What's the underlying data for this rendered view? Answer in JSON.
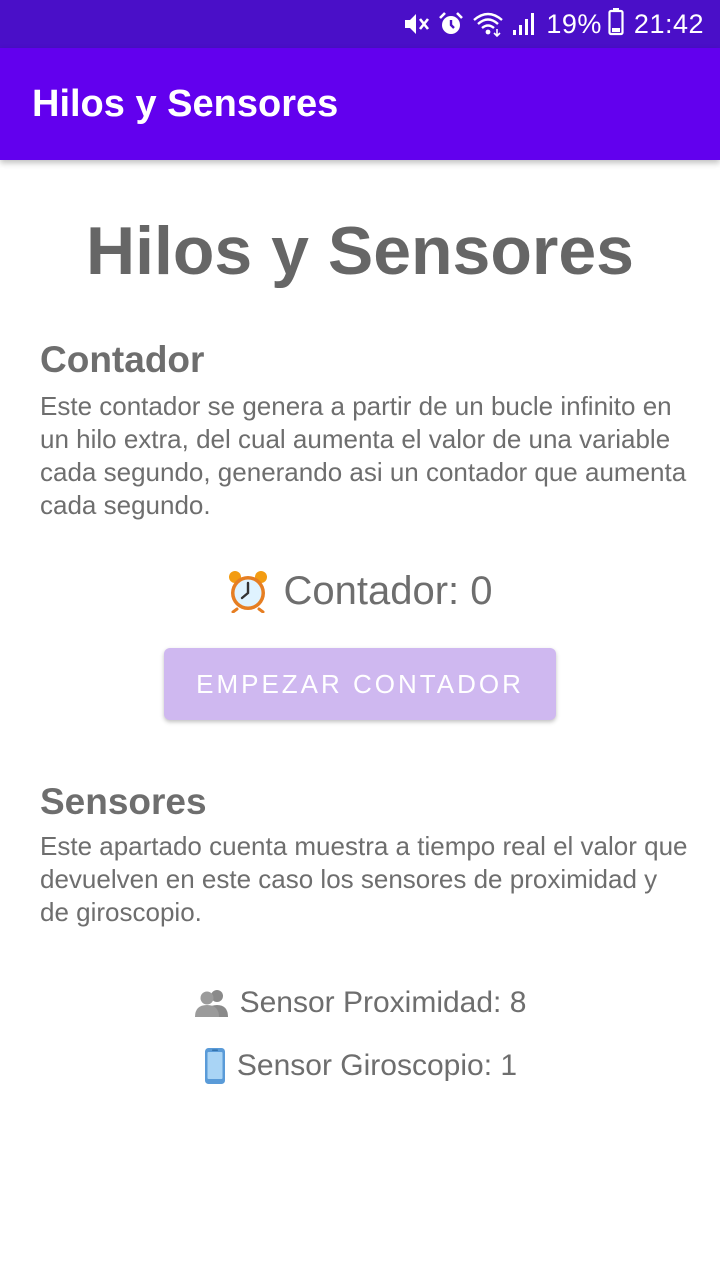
{
  "status_bar": {
    "battery_percent": "19%",
    "time": "21:42",
    "icons": [
      "mute-icon",
      "alarm-icon",
      "wifi-icon",
      "signal-icon",
      "battery-icon"
    ],
    "background_color": "#4a0fc8"
  },
  "app_bar": {
    "title": "Hilos y Sensores",
    "background_color": "#6200ee"
  },
  "main": {
    "page_title": "Hilos y Sensores",
    "counter_section": {
      "title": "Contador",
      "description": "Este contador se genera a partir de un bucle infinito en un hilo extra, del cual aumenta el valor de una variable cada segundo, generando asi un contador que aumenta cada segundo.",
      "counter_icon": "alarm-clock-icon",
      "counter_text": "Contador: 0",
      "button_label": "EMPEZAR CONTADOR",
      "button_color": "#cfb8f0"
    },
    "sensors_section": {
      "title": "Sensores",
      "description": "Este apartado cuenta muestra a tiempo real el valor que devuelven en este caso los sensores de proximidad y de giroscopio.",
      "proximity_icon": "people-icon",
      "proximity_text": "Sensor Proximidad: 8",
      "gyroscope_icon": "mobile-phone-icon",
      "gyroscope_text": "Sensor Giroscopio: 1"
    }
  }
}
